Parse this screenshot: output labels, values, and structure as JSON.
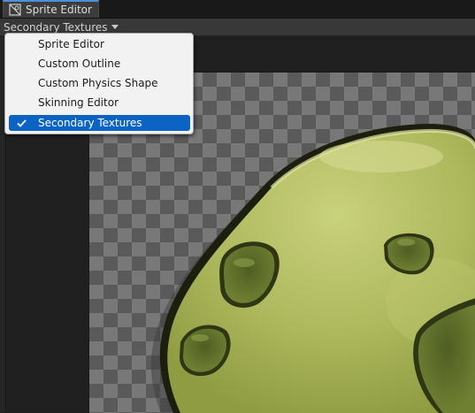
{
  "window": {
    "tab_title": "Sprite Editor",
    "tab_icon": "sprite-editor-icon"
  },
  "toolbar": {
    "mode_dropdown_label": "Secondary Textures",
    "caret_icon": "caret-down-icon"
  },
  "menu": {
    "items": [
      {
        "label": "Sprite Editor",
        "checked": false
      },
      {
        "label": "Custom Outline",
        "checked": false
      },
      {
        "label": "Custom Physics Shape",
        "checked": false
      },
      {
        "label": "Skinning Editor",
        "checked": false
      },
      {
        "label": "Secondary Textures",
        "checked": true
      }
    ],
    "selected_highlight_color": "#0b64c4",
    "check_icon": "checkmark-icon"
  },
  "canvas": {
    "background": "transparency-checkerboard",
    "sprite": "green-blob-sprite"
  },
  "colors": {
    "sprite_body": "#a9b95a",
    "sprite_outline": "#1c1f0d",
    "sprite_spots": "#5e6e2a"
  }
}
